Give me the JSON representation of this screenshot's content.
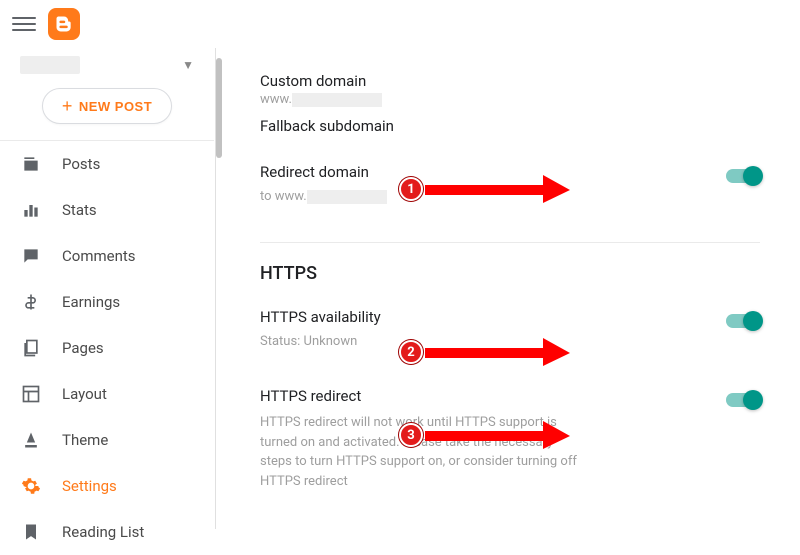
{
  "header": {
    "new_post_label": "NEW POST"
  },
  "sidebar": {
    "items": [
      {
        "label": "Posts"
      },
      {
        "label": "Stats"
      },
      {
        "label": "Comments"
      },
      {
        "label": "Earnings"
      },
      {
        "label": "Pages"
      },
      {
        "label": "Layout"
      },
      {
        "label": "Theme"
      },
      {
        "label": "Settings"
      },
      {
        "label": "Reading List"
      }
    ]
  },
  "settings": {
    "custom_domain": {
      "label": "Custom domain",
      "value_prefix": "www."
    },
    "fallback_subdomain": {
      "label": "Fallback subdomain"
    },
    "redirect_domain": {
      "label": "Redirect domain",
      "to_prefix": "to www."
    },
    "https": {
      "section_title": "HTTPS",
      "availability_label": "HTTPS availability",
      "availability_status": "Status: Unknown",
      "redirect_label": "HTTPS redirect",
      "redirect_desc": "HTTPS redirect will not work until HTTPS support is turned on and activated. Please take the necessary steps to turn HTTPS support on, or consider turning off HTTPS redirect"
    }
  },
  "annotations": {
    "a1": "1",
    "a2": "2",
    "a3": "3"
  }
}
